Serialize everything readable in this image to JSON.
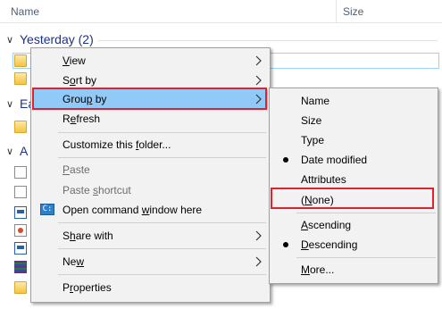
{
  "columns": {
    "name": "Name",
    "size": "Size"
  },
  "groups": [
    {
      "label": "Yesterday (2)"
    },
    {
      "label": "Ea"
    },
    {
      "label": "A l"
    }
  ],
  "context_menu": {
    "items": [
      {
        "label": "View",
        "access_key": "V",
        "submenu": true
      },
      {
        "label": "Sort by",
        "access_key": "o",
        "submenu": true
      },
      {
        "label": "Group by",
        "access_key": "p",
        "submenu": true,
        "highlighted": true
      },
      {
        "label": "Refresh",
        "access_key": "e"
      },
      {
        "label": "Customize this folder...",
        "access_key": "f"
      },
      {
        "label": "Paste",
        "access_key": "P",
        "disabled": true
      },
      {
        "label": "Paste shortcut",
        "access_key": "s",
        "disabled": true
      },
      {
        "label": "Open command window here",
        "access_key": "w",
        "icon": "command-prompt-icon"
      },
      {
        "label": "Share with",
        "access_key": "h",
        "submenu": true
      },
      {
        "label": "New",
        "access_key": "w",
        "submenu": true
      },
      {
        "label": "Properties",
        "access_key": "r"
      }
    ]
  },
  "group_by_submenu": {
    "items": [
      {
        "label": "Name"
      },
      {
        "label": "Size"
      },
      {
        "label": "Type"
      },
      {
        "label": "Date modified",
        "checked": true
      },
      {
        "label": "Attributes"
      },
      {
        "label": "(None)",
        "access_key": "N",
        "annotated": true
      },
      {
        "label": "Ascending",
        "access_key": "A"
      },
      {
        "label": "Descending",
        "access_key": "D",
        "checked": true
      },
      {
        "label": "More...",
        "access_key": "M"
      }
    ]
  },
  "colors": {
    "menu_bg": "#f2f2f2",
    "highlight": "#91c9f7",
    "annotation": "#e1222d",
    "group_header": "#1e3287"
  }
}
